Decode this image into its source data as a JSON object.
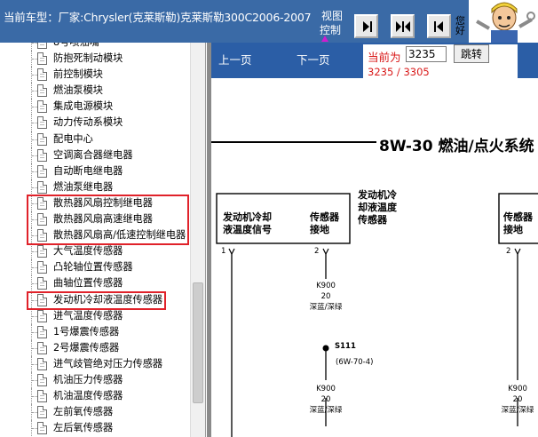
{
  "header": {
    "title": "当前车型：厂家:Chrysler(克莱斯勒)克莱斯勒300C2006-2007",
    "view_label_1": "视图",
    "view_label_2": "控制",
    "partial_text": [
      "您",
      "好"
    ],
    "colors": {
      "bar": "#3a6aa6",
      "text": "#ffffff"
    }
  },
  "nav_buttons": [
    {
      "name": "show-right-button",
      "icon": "arrow-right-bar-icon"
    },
    {
      "name": "show-both-button",
      "icon": "split-arrows-icon"
    },
    {
      "name": "show-left-button",
      "icon": "arrow-left-bar-icon"
    }
  ],
  "sidebar": {
    "items": [
      {
        "label": "8号喷油嘴",
        "highlight": false
      },
      {
        "label": "防抱死制动模块",
        "highlight": false
      },
      {
        "label": "前控制模块",
        "highlight": false
      },
      {
        "label": "燃油泵模块",
        "highlight": false
      },
      {
        "label": "集成电源模块",
        "highlight": false
      },
      {
        "label": "动力传动系模块",
        "highlight": false
      },
      {
        "label": "配电中心",
        "highlight": false
      },
      {
        "label": "空调离合器继电器",
        "highlight": false
      },
      {
        "label": "自动断电继电器",
        "highlight": false
      },
      {
        "label": "燃油泵继电器",
        "highlight": false
      },
      {
        "label": "散热器风扇控制继电器",
        "highlight": true
      },
      {
        "label": "散热器风扇高速继电器",
        "highlight": true
      },
      {
        "label": "散热器风扇高/低速控制继电器",
        "highlight": true
      },
      {
        "label": "大气温度传感器",
        "highlight": false
      },
      {
        "label": "凸轮轴位置传感器",
        "highlight": false
      },
      {
        "label": "曲轴位置传感器",
        "highlight": false
      },
      {
        "label": "发动机冷却液温度传感器",
        "highlight": true
      },
      {
        "label": "进气温度传感器",
        "highlight": false
      },
      {
        "label": "1号爆震传感器",
        "highlight": false
      },
      {
        "label": "2号爆震传感器",
        "highlight": false
      },
      {
        "label": "进气歧管绝对压力传感器",
        "highlight": false
      },
      {
        "label": "机油压力传感器",
        "highlight": false
      },
      {
        "label": "机油温度传感器",
        "highlight": false
      },
      {
        "label": "左前氧传感器",
        "highlight": false
      },
      {
        "label": "左后氧传感器",
        "highlight": false
      }
    ],
    "highlight_color": "#e0222a"
  },
  "viewer": {
    "prev_label": "上一页",
    "next_label": "下一页",
    "current_label": "当前为",
    "current_value": "3235",
    "jump_label": "跳转",
    "page_count": "3235 / 3305",
    "colors": {
      "strip": "#2b5ea6",
      "accent": "#d91a1a"
    }
  },
  "diagram": {
    "heading": "8W-30 燃油/点火系统",
    "col1": {
      "pin": "1",
      "text": [
        "发动机冷却",
        "液温度信号"
      ]
    },
    "col2": {
      "pin": "2",
      "text": [
        "传感器",
        "接地"
      ]
    },
    "side_label": [
      "发动机冷",
      "却液温度",
      "传感器"
    ],
    "col3": {
      "pin": "2",
      "text": [
        "传感器",
        "接地"
      ]
    },
    "wire1": {
      "code": "K900",
      "gauge": "20",
      "color": "深蓝/深绿"
    },
    "splice": {
      "id": "S111",
      "ref": "(6W-70-4)"
    },
    "wire2": {
      "code": "K900",
      "gauge": "20",
      "color": "深蓝/深绿"
    },
    "wire3": {
      "code": "K900",
      "gauge": "20",
      "color": "深蓝/深绿"
    }
  }
}
